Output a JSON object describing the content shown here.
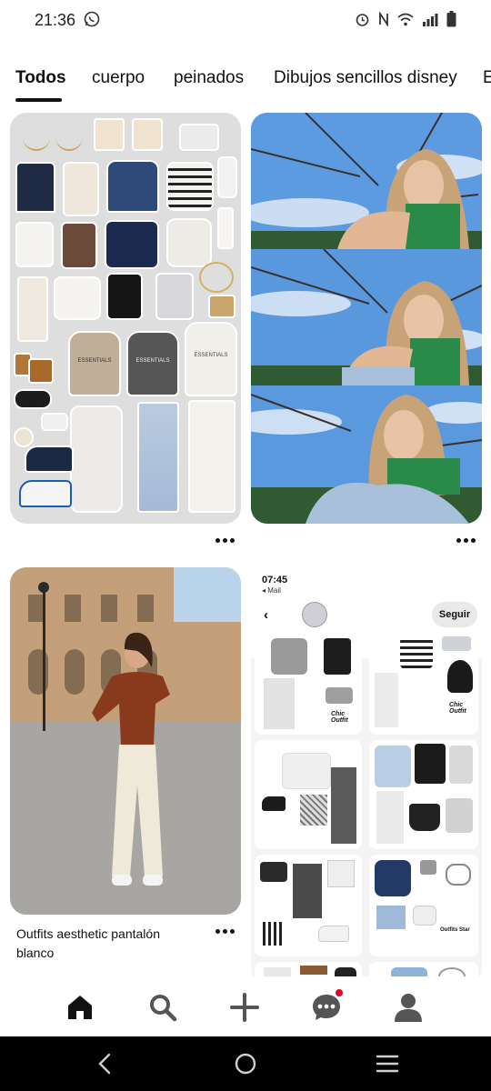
{
  "status_bar": {
    "time": "21:36",
    "icons": [
      "whatsapp-icon",
      "alarm-icon",
      "nfc-icon",
      "wifi-icon",
      "signal-icon",
      "battery-icon"
    ]
  },
  "tabs": [
    {
      "label": "Todos",
      "active": true
    },
    {
      "label": "cuerpo",
      "active": false
    },
    {
      "label": "peinados",
      "active": false
    },
    {
      "label": "Dibujos sencillos disney",
      "active": false
    },
    {
      "label": "E",
      "active": false
    }
  ],
  "pins": [
    {
      "id": "clothing-collage",
      "caption": "",
      "image_text": "ESSENTIALS"
    },
    {
      "id": "sky-selfie",
      "caption": ""
    },
    {
      "id": "street-outfit",
      "caption": "Outfits aesthetic pantalón blanco"
    },
    {
      "id": "outfit-boards-screenshot",
      "caption": "",
      "screenshot": {
        "time": "07:45",
        "mail_label": "◂ Mail",
        "follow_label": "Seguir",
        "board_tags": [
          "Chic Outfit",
          "Chic Outfit",
          "Outfits Star"
        ]
      }
    }
  ],
  "bottom_nav": [
    {
      "icon": "home-icon",
      "active": true
    },
    {
      "icon": "search-icon",
      "active": false
    },
    {
      "icon": "add-icon",
      "active": false
    },
    {
      "icon": "messages-icon",
      "active": false,
      "notification": true
    },
    {
      "icon": "profile-icon",
      "active": false
    }
  ],
  "system_nav": [
    "back-icon",
    "home-circle-icon",
    "recents-icon"
  ],
  "colors": {
    "notification": "#e60023",
    "sky": "#4f8fd8",
    "sweater": "#8a3a1c"
  }
}
